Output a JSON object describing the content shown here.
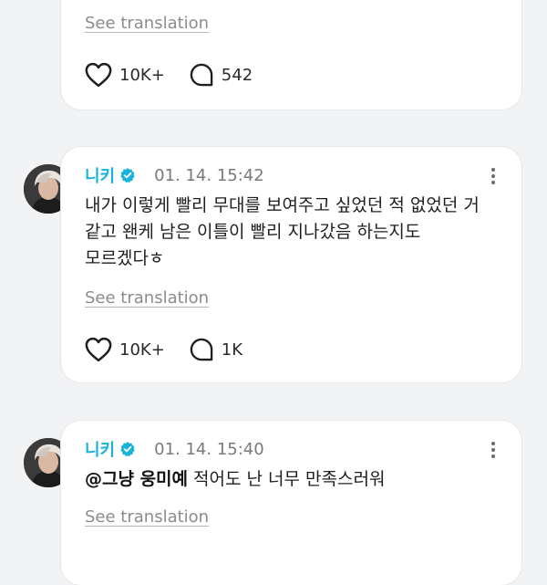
{
  "comment1": {
    "see_translation": "See translation",
    "likes": "10K+",
    "replies": "542"
  },
  "comment2": {
    "author": "니키",
    "time": "01. 14. 15:42",
    "text": "내가 이렇게 빨리 무대를 보여주고 싶었던 적 없었던 거 같고 왠케 남은 이틀이 빨리 지나갔음 하는지도 모르겠다ㅎ",
    "see_translation": "See translation",
    "likes": "10K+",
    "replies": "1K"
  },
  "comment3": {
    "author": "니키",
    "time": "01. 14. 15:40",
    "mention": "@그냥 웅미예",
    "text": " 적어도 난 너무 만족스러워",
    "see_translation": "See translation"
  },
  "colors": {
    "author": "#17b3d8",
    "verified_badge": "#17b3d8",
    "background": "#f2f3f5",
    "card": "#ffffff"
  },
  "icons": [
    "heart-icon",
    "comment-bubble-icon",
    "verified-badge-icon",
    "more-options-icon"
  ]
}
